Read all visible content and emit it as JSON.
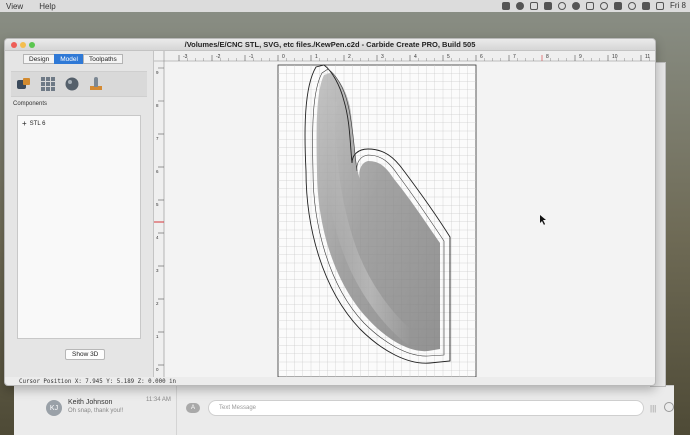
{
  "menubar": {
    "items": [
      "View",
      "Help"
    ],
    "clock": "Fri 8"
  },
  "window": {
    "title": "/Volumes/E/CNC STL, SVG, etc files./KewPen.c2d - Carbide Create PRO, Build 505"
  },
  "tabs": [
    {
      "label": "Design",
      "active": false
    },
    {
      "label": "Model",
      "active": true
    },
    {
      "label": "Toolpaths",
      "active": false
    }
  ],
  "toolbar": {
    "tools": [
      "import-model-icon",
      "grid-tool-icon",
      "sphere-tool-icon",
      "stamp-tool-icon"
    ]
  },
  "components": {
    "label": "Components",
    "items": [
      {
        "label": "STL 6"
      }
    ]
  },
  "buttons": {
    "show3d": "Show 3D"
  },
  "status": {
    "cursor_position": "Cursor Position X: 7.945 Y: 5.189 Z: 0.000 in"
  },
  "ruler": {
    "x_ticks": [
      "-3",
      "-2",
      "-1",
      "0",
      "1",
      "2",
      "3",
      "4",
      "5",
      "6",
      "7",
      "8",
      "9",
      "10",
      "11"
    ],
    "y_ticks": [
      "9",
      "8",
      "7",
      "6",
      "5",
      "4",
      "3",
      "2",
      "1",
      "0"
    ]
  },
  "messages": {
    "avatar_initials": "KJ",
    "sender": "Keith Johnson",
    "time": "11:34 AM",
    "snippet": "Oh snap, thank you!!",
    "input_placeholder": "Text Message",
    "apps_label": "A"
  },
  "colors": {
    "accent": "#2f79d6",
    "grid": "#c9c9c9",
    "stock_border": "#333333",
    "toolpath": "#222222",
    "ruler_mark": "#d6353a"
  }
}
